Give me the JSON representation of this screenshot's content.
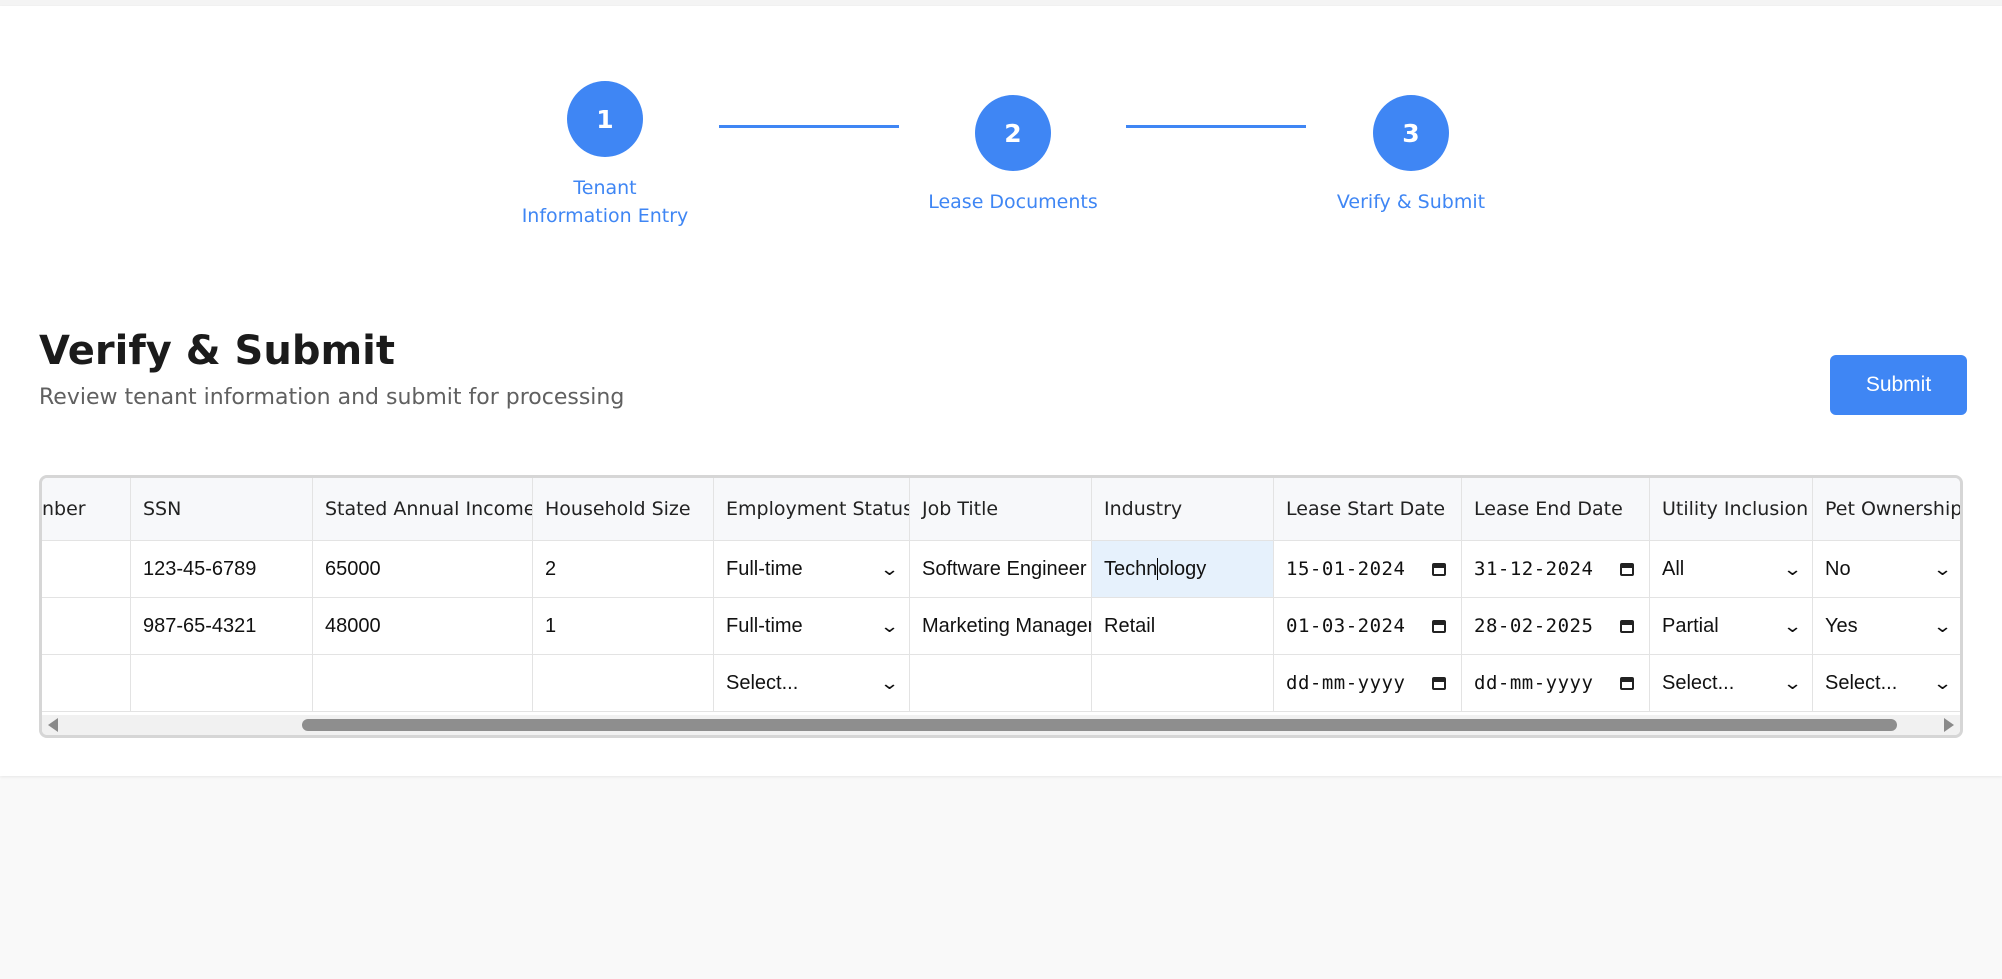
{
  "stepper": {
    "steps": [
      {
        "number": "1",
        "label_line1": "Tenant",
        "label_line2": "Information Entry"
      },
      {
        "number": "2",
        "label": "Lease Documents"
      },
      {
        "number": "3",
        "label": "Verify & Submit"
      }
    ]
  },
  "header": {
    "title": "Verify & Submit",
    "subtitle": "Review tenant information and submit for processing",
    "submit_label": "Submit"
  },
  "table": {
    "columns": [
      "nber",
      "SSN",
      "Stated Annual Income",
      "Household Size",
      "Employment Status",
      "Job Title",
      "Industry",
      "Lease Start Date",
      "Lease End Date",
      "Utility Inclusion",
      "Pet Ownership"
    ],
    "rows": [
      {
        "ssn": "123-45-6789",
        "income": "65000",
        "household": "2",
        "employment": "Full-time",
        "job_title": "Software Engineer",
        "industry_a": "Techn",
        "industry_b": "ology",
        "lease_start": "15-01-2024",
        "lease_end": "31-12-2024",
        "utility": "All",
        "pet": "No"
      },
      {
        "ssn": "987-65-4321",
        "income": "48000",
        "household": "1",
        "employment": "Full-time",
        "job_title": "Marketing Manager",
        "industry": "Retail",
        "lease_start": "01-03-2024",
        "lease_end": "28-02-2025",
        "utility": "Partial",
        "pet": "Yes"
      },
      {
        "ssn": "",
        "income": "",
        "household": "",
        "employment": "Select...",
        "job_title": "",
        "industry": "",
        "lease_start": "dd-mm-yyyy",
        "lease_end": "dd-mm-yyyy",
        "utility": "Select...",
        "pet": "Select..."
      }
    ]
  },
  "icons": {
    "select_chevron": "chevron-down-icon",
    "date_picker": "calendar-icon",
    "scroll_left": "scroll-left-arrow-icon",
    "scroll_right": "scroll-right-arrow-icon"
  },
  "colors": {
    "accent": "#3f86f4",
    "focus_cell": "#e6f1fc"
  }
}
